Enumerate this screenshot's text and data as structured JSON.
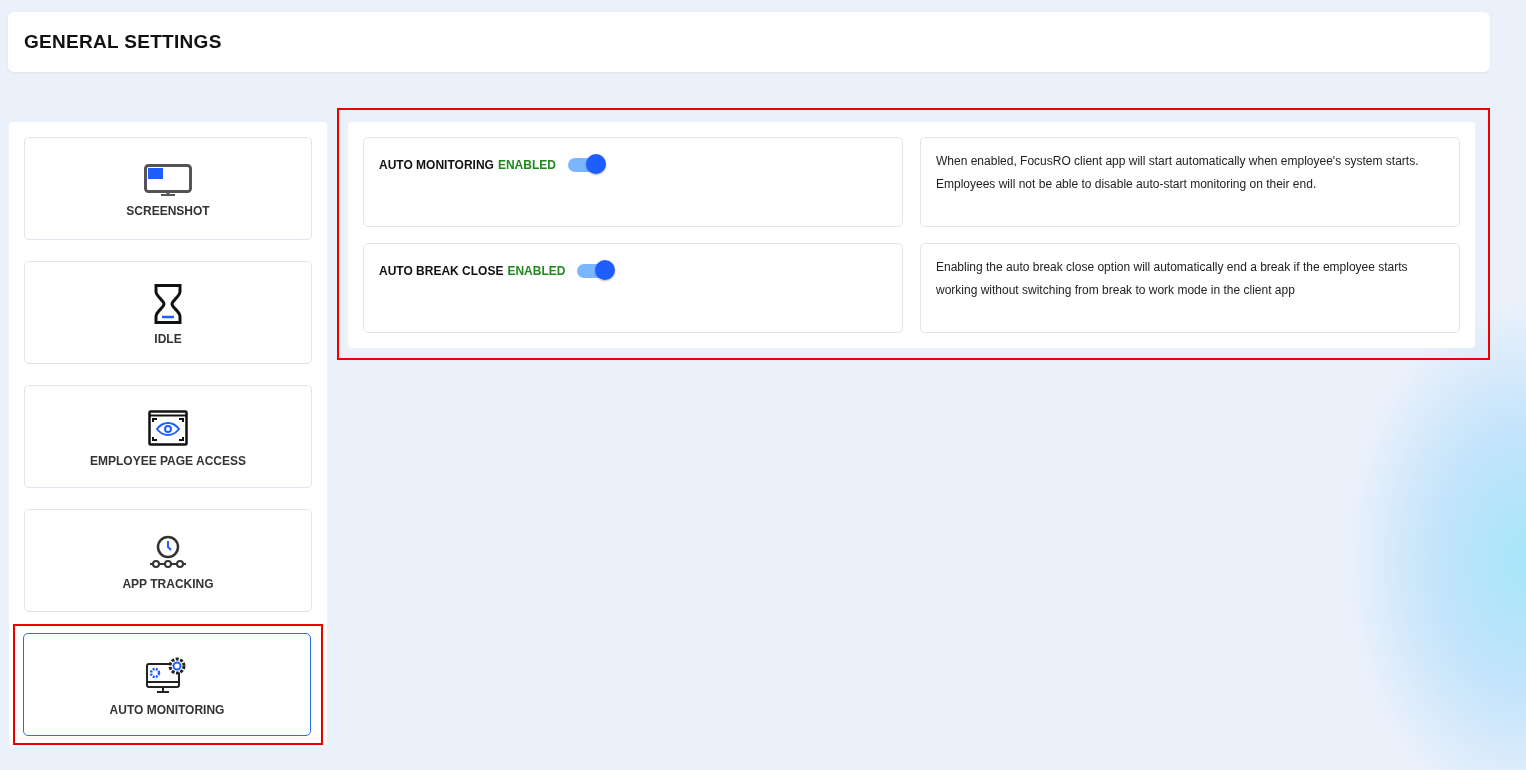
{
  "header": {
    "title": "GENERAL SETTINGS"
  },
  "tabs": [
    {
      "kind": "monitor",
      "label": "SCREENSHOT",
      "selected": false
    },
    {
      "kind": "hourglass",
      "label": "IDLE",
      "selected": false
    },
    {
      "kind": "eye-window",
      "label": "EMPLOYEE PAGE ACCESS",
      "selected": false
    },
    {
      "kind": "clock",
      "label": "APP TRACKING",
      "selected": false
    },
    {
      "kind": "monitor-gear",
      "label": "AUTO MONITORING",
      "selected": true
    }
  ],
  "settings": [
    {
      "label": "AUTO MONITORING",
      "status": "ENABLED",
      "on": true,
      "description": "When enabled, FocusRO client app will start automatically when employee's system starts. Employees will not be able to disable auto-start monitoring on their end."
    },
    {
      "label": "AUTO BREAK CLOSE",
      "status": "ENABLED",
      "on": true,
      "description": "Enabling the auto break close option will automatically end a break if the employee starts working without switching from break to work mode in the client app"
    }
  ]
}
